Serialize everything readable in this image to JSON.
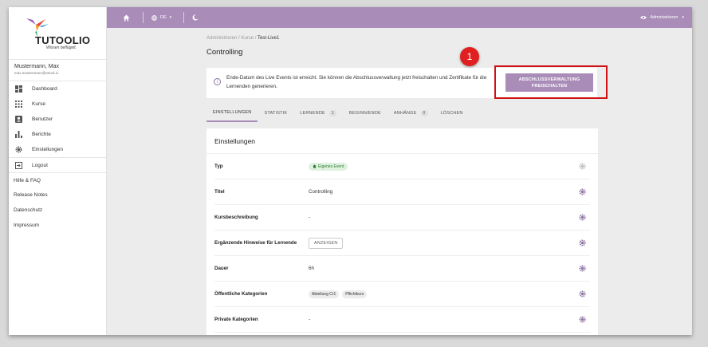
{
  "app": {
    "logo_text": "TUTOOLIO",
    "logo_sub": "Wissen beflügelt."
  },
  "user": {
    "name": "Mustermann, Max",
    "email": "max.mustermann@tutool.io"
  },
  "sidebar": {
    "items": [
      {
        "label": "Dashboard",
        "icon": "dashboard-icon"
      },
      {
        "label": "Kurse",
        "icon": "grid-icon"
      },
      {
        "label": "Benutzer",
        "icon": "person-icon"
      },
      {
        "label": "Berichte",
        "icon": "bar-chart-icon"
      },
      {
        "label": "Einstellungen",
        "icon": "gear-icon"
      }
    ],
    "logout": "Logout",
    "links": [
      "Hilfe & FAQ",
      "Release Notes",
      "Datenschutz",
      "Impressum"
    ]
  },
  "topbar": {
    "language": "DE",
    "role": "Administrieren"
  },
  "breadcrumb": {
    "root": "Administrieren",
    "sep": "/",
    "mid": "Kurse",
    "current": "Test-Live1"
  },
  "page_title": "Controlling",
  "alert": {
    "text": "Ende-Datum des Live Events ist erreicht. Sie können die Abschlussverwaltung jetzt freischalten und Zertifikate für die Lernenden generieren.",
    "button_line1": "ABSCHLUSSVERWALTUNG",
    "button_line2": "FREISCHALTEN"
  },
  "annotation": {
    "number": "1"
  },
  "tabs": [
    {
      "label": "EINSTELLUNGEN",
      "active": true
    },
    {
      "label": "STATISTIK"
    },
    {
      "label": "LERNENDE",
      "count": "1"
    },
    {
      "label": "BEGINN/ENDE"
    },
    {
      "label": "ANHÄNGE",
      "count": "0"
    },
    {
      "label": "LÖSCHEN"
    }
  ],
  "settings": {
    "heading": "Einstellungen",
    "rows": {
      "typ": {
        "label": "Typ",
        "value": "Eigenes Event"
      },
      "titel": {
        "label": "Titel",
        "value": "Controlling"
      },
      "beschreibung": {
        "label": "Kursbeschreibung",
        "value": "-"
      },
      "hinweise": {
        "label": "Ergänzende Hinweise für Lernende",
        "button": "ANZEIGEN"
      },
      "dauer": {
        "label": "Dauer",
        "value": "6h"
      },
      "oeff": {
        "label": "Öffentliche Kategorien",
        "chips": [
          "Abteilung Cr1",
          "Pflichtkurs"
        ]
      },
      "priv": {
        "label": "Private Kategorien",
        "value": "-"
      }
    }
  },
  "colors": {
    "accent": "#a98cb8",
    "highlight": "#d01212",
    "badge": "#e02020",
    "success": "#2e7d32"
  }
}
